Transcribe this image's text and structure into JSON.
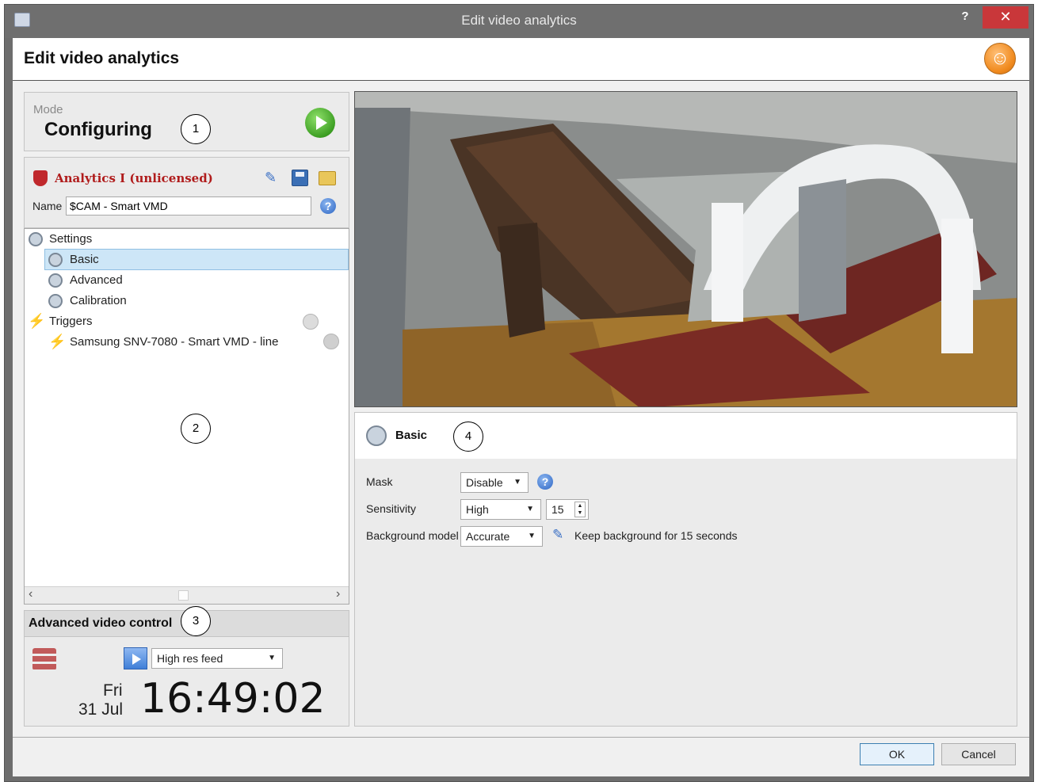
{
  "window": {
    "title": "Edit video analytics",
    "help_glyph": "?",
    "close_glyph": "✕"
  },
  "header": {
    "title": "Edit video analytics"
  },
  "mode": {
    "label": "Mode",
    "value": "Configuring"
  },
  "callouts": [
    "1",
    "2",
    "3",
    "4"
  ],
  "analytics": {
    "title": "Analytics I (unlicensed)",
    "name_label": "Name",
    "name_value": "$CAM - Smart VMD",
    "help_glyph": "?"
  },
  "tree": {
    "settings": "Settings",
    "basic": "Basic",
    "advanced": "Advanced",
    "calibration": "Calibration",
    "triggers": "Triggers",
    "trigger_item": "Samsung SNV-7080 - Smart VMD - line"
  },
  "scroll": {
    "left": "‹",
    "right": "›"
  },
  "video_control": {
    "title": "Advanced video control",
    "feed": "High res feed",
    "day": "Fri",
    "date": "31 Jul",
    "time": "16:49:02"
  },
  "basic_panel": {
    "title": "Basic",
    "mask_label": "Mask",
    "mask_value": "Disable",
    "sensitivity_label": "Sensitivity",
    "sensitivity_value": "High",
    "sensitivity_number": "15",
    "background_label": "Background model",
    "background_value": "Accurate",
    "keep_text": "Keep background for 15 seconds",
    "help_glyph": "?"
  },
  "buttons": {
    "ok": "OK",
    "cancel": "Cancel"
  },
  "colors": {
    "title_bar": "#6f6f6f",
    "close": "#c9373a",
    "analytics_title": "#b01c1c",
    "selection": "#cde6f7"
  }
}
